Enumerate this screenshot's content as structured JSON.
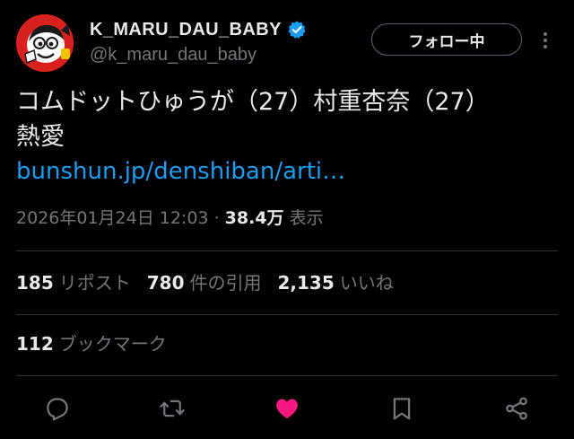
{
  "author": {
    "display_name": "K_MARU_DAU_BABY",
    "handle": "@k_maru_dau_baby",
    "verified": true,
    "avatar_icon": "mascot-avatar-icon"
  },
  "follow_button": {
    "label": "フォロー中"
  },
  "tweet": {
    "text_line1": "コムドットひゅうが（27）村重杏奈（27）",
    "text_line2": "熱愛",
    "link_text": "bunshun.jp/denshiban/arti…",
    "timestamp": "2026年01月24日 12:03",
    "separator": "·",
    "views_count": "38.4万",
    "views_label": "表示"
  },
  "stats": {
    "reposts_count": "185",
    "reposts_label": "リポスト",
    "quotes_count": "780",
    "quotes_label": "件の引用",
    "likes_count": "2,135",
    "likes_label": "いいね",
    "bookmarks_count": "112",
    "bookmarks_label": "ブックマーク"
  },
  "actions": [
    {
      "icon": "reply-icon"
    },
    {
      "icon": "repost-icon"
    },
    {
      "icon": "like-icon",
      "active": true
    },
    {
      "icon": "bookmark-icon"
    },
    {
      "icon": "share-icon"
    }
  ],
  "colors": {
    "background": "#000000",
    "text_primary": "#e7e9ea",
    "text_secondary": "#71767b",
    "link": "#1d9bf0",
    "verified": "#1d9bf0",
    "like_active": "#f91880",
    "divider": "#2f3336",
    "avatar_bg": "#d8201f"
  }
}
